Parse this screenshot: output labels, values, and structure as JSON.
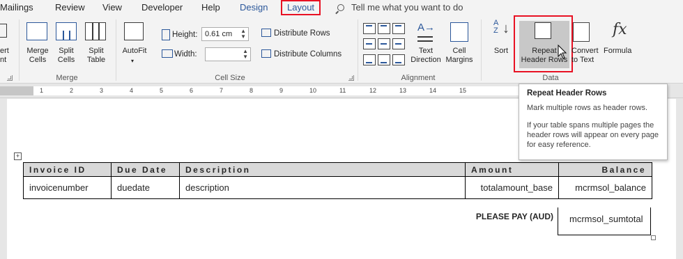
{
  "tabs": [
    "Mailings",
    "Review",
    "View",
    "Developer",
    "Help",
    "Design",
    "Layout"
  ],
  "tell_me": "Tell me what you want to do",
  "ribbon": {
    "insert_partial": [
      "ert",
      "nt"
    ],
    "merge": {
      "merge_cells": [
        "Merge",
        "Cells"
      ],
      "split_cells": [
        "Split",
        "Cells"
      ],
      "split_table": [
        "Split",
        "Table"
      ],
      "group": "Merge"
    },
    "cell_size": {
      "autofit": "AutoFit",
      "height_label": "Height:",
      "height_value": "0.61 cm",
      "width_label": "Width:",
      "width_value": "",
      "distribute_rows": "Distribute Rows",
      "distribute_columns": "Distribute Columns",
      "group": "Cell Size"
    },
    "alignment": {
      "text_direction": [
        "Text",
        "Direction"
      ],
      "cell_margins": [
        "Cell",
        "Margins"
      ],
      "group": "Alignment"
    },
    "data": {
      "sort": "Sort",
      "repeat_header_rows": [
        "Repeat",
        "Header Rows"
      ],
      "convert_to_text": [
        "Convert",
        "to Text"
      ],
      "formula": "Formula",
      "group": "Data"
    }
  },
  "ruler": [
    "1",
    "2",
    "3",
    "4",
    "5",
    "6",
    "7",
    "8",
    "9",
    "10",
    "11",
    "12",
    "13",
    "14",
    "15"
  ],
  "tooltip": {
    "title": "Repeat Header Rows",
    "line1": "Mark multiple rows as header rows.",
    "line2": "If your table spans multiple pages the header rows will appear on every page for easy reference."
  },
  "table": {
    "headers": [
      "Invoice ID",
      "Due Date",
      "Description",
      "Amount",
      "Balance"
    ],
    "row": [
      "invoicenumber",
      "duedate",
      "description",
      "totalamount_base",
      "mcrmsol_balance"
    ],
    "pay_label": "PLEASE PAY (AUD)",
    "sum_value": "mcrmsol_sumtotal"
  },
  "colors": {
    "accent": "#2b579a",
    "highlight_border": "#e81123",
    "header_fill": "#d9d9d9"
  },
  "icons": [
    "search-icon",
    "table-merge-icon",
    "table-split-icon",
    "autofit-icon",
    "sort-icon",
    "formula-icon",
    "cursor-icon"
  ]
}
